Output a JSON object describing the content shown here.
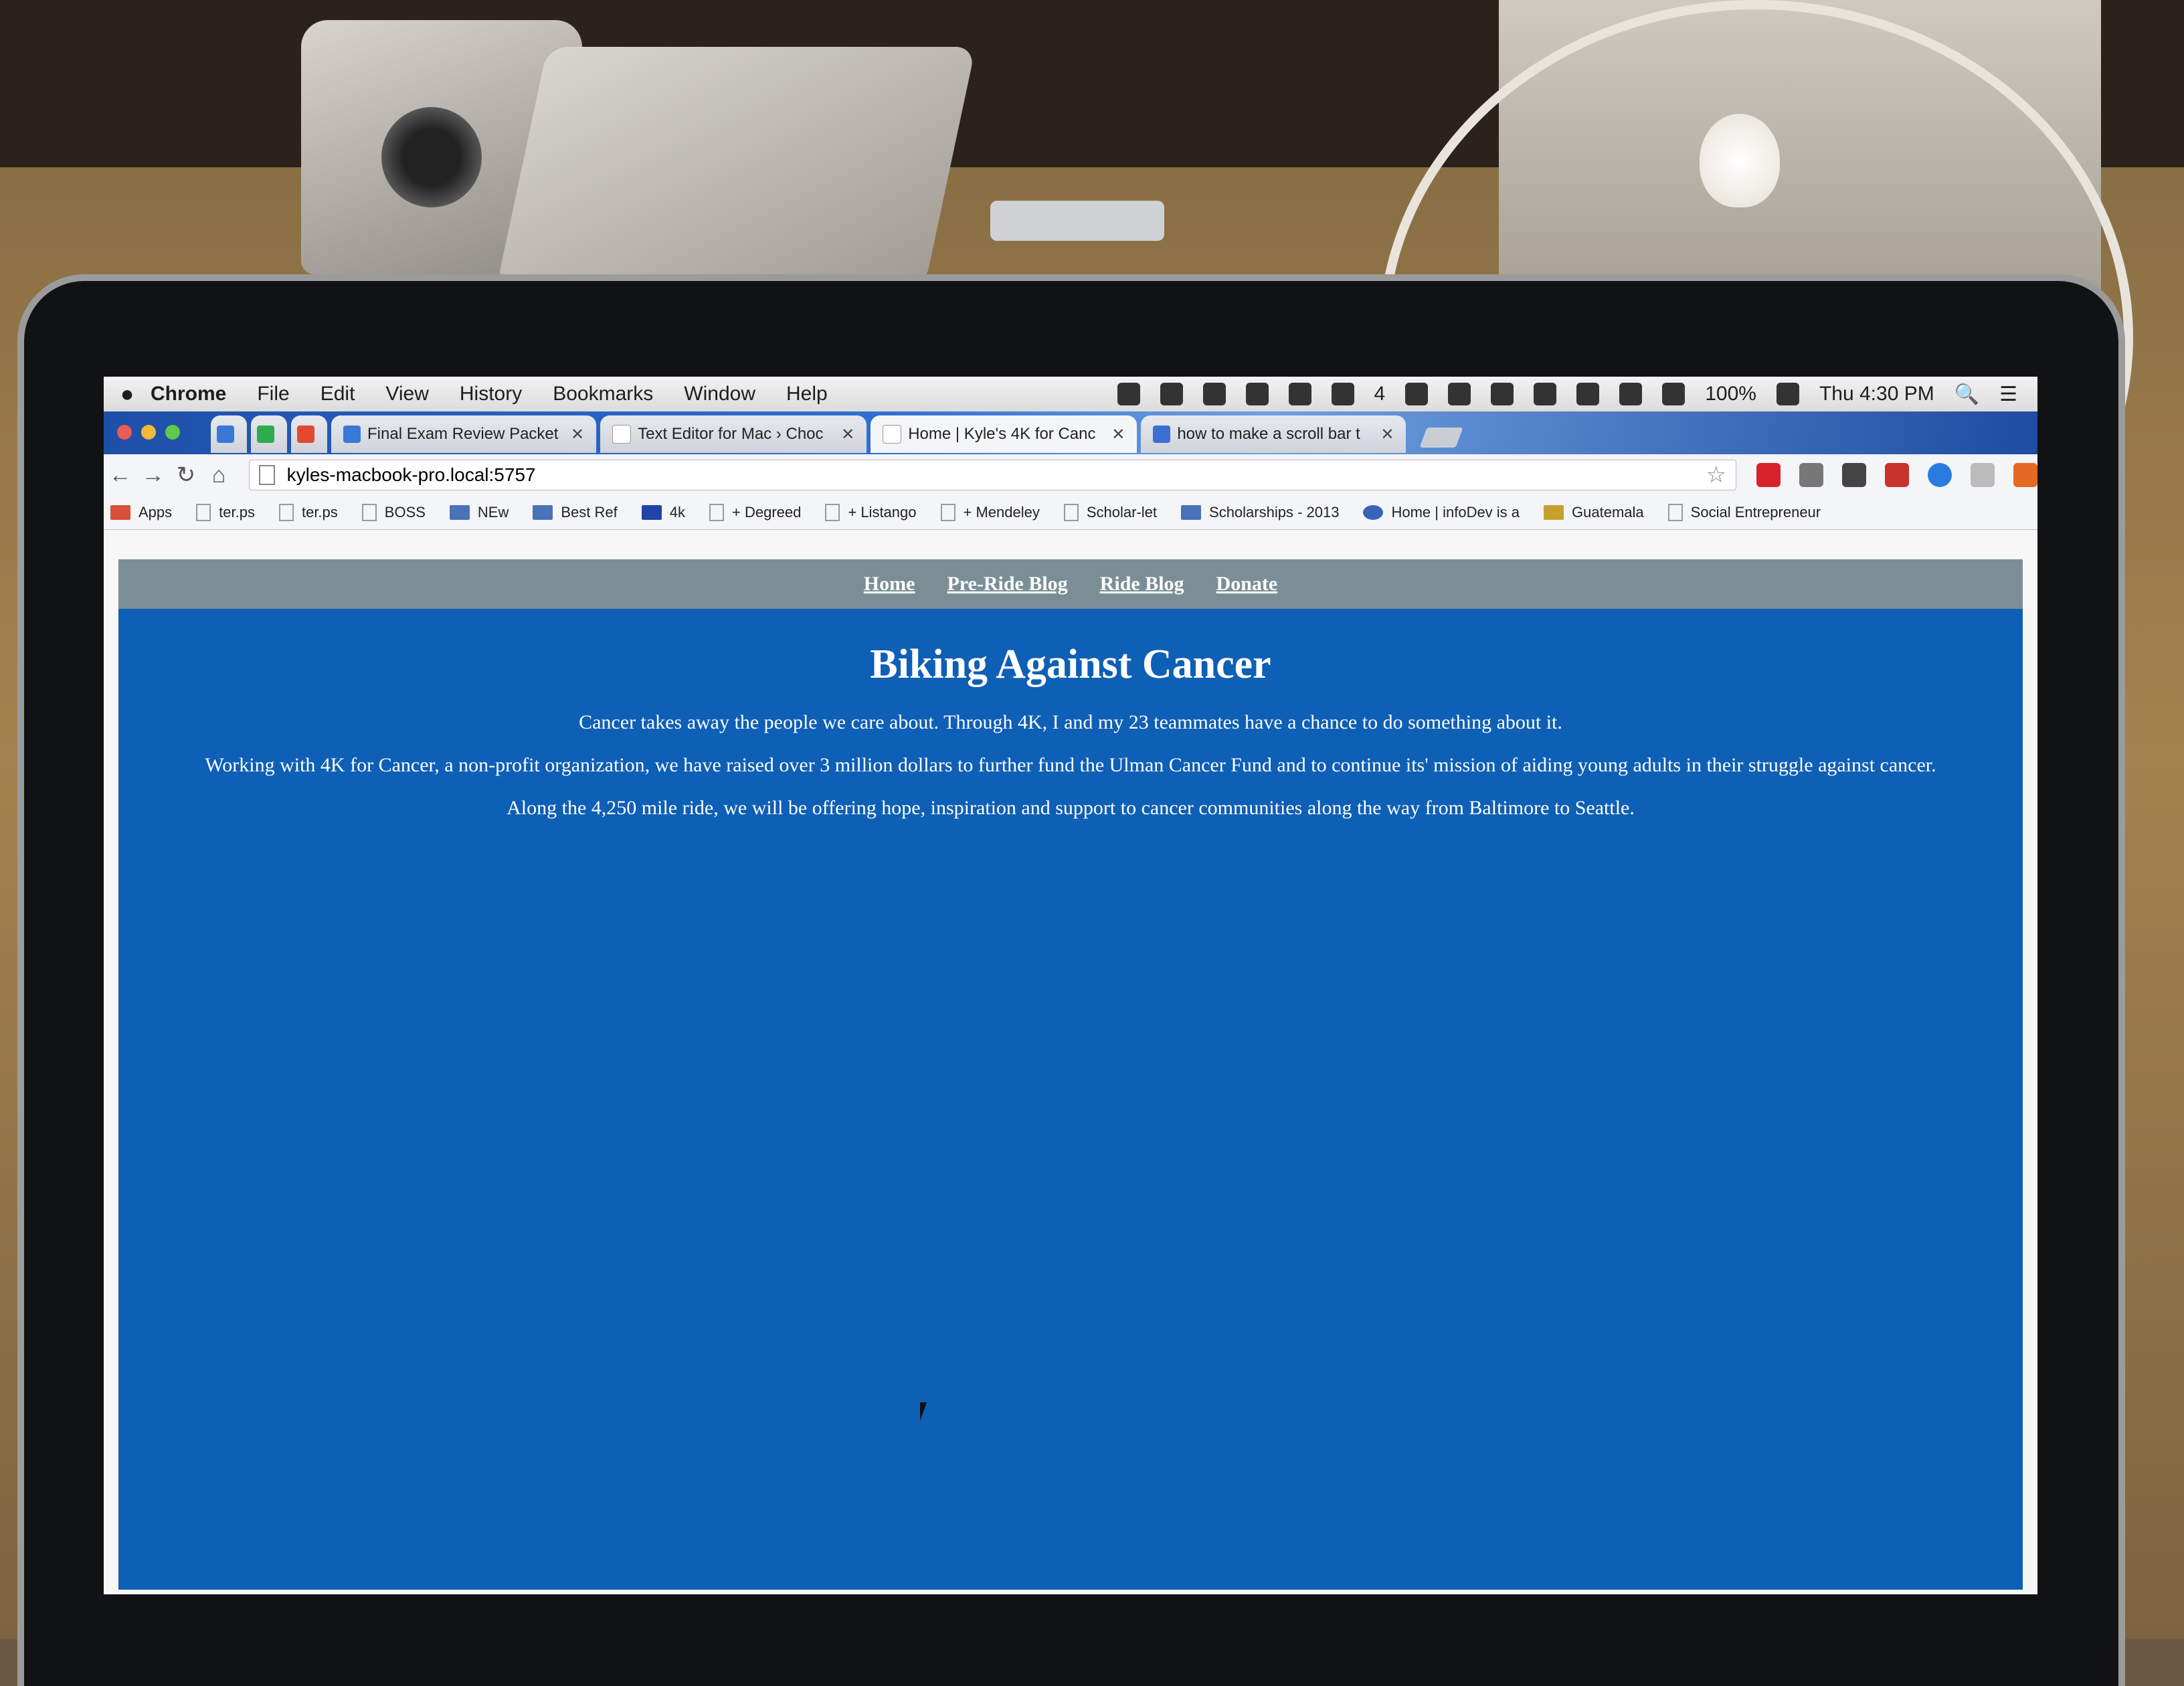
{
  "menubar": {
    "app": "Chrome",
    "items": [
      "File",
      "Edit",
      "View",
      "History",
      "Bookmarks",
      "Window",
      "Help"
    ],
    "battery": "100%",
    "clock": "Thu 4:30 PM",
    "badge": "4"
  },
  "tabs": [
    {
      "title": "Final Exam Review Packet",
      "icon": "docs-icon"
    },
    {
      "title": "Text Editor for Mac › Choc",
      "icon": "page-icon"
    },
    {
      "title": "Home | Kyle's 4K for Canc",
      "icon": "page-icon"
    },
    {
      "title": "how to make a scroll bar t",
      "icon": "google-icon"
    }
  ],
  "omnibox": {
    "url": "kyles-macbook-pro.local:5757"
  },
  "bookmarks": [
    "Apps",
    "ter.ps",
    "ter.ps",
    "BOSS",
    "NEw",
    "Best Ref",
    "4k",
    "+ Degreed",
    "+ Listango",
    "+ Mendeley",
    "Scholar-let",
    "Scholarships - 2013",
    "Home | infoDev is a",
    "Guatemala",
    "Social Entrepreneur"
  ],
  "site": {
    "nav": [
      "Home",
      "Pre-Ride Blog",
      "Ride Blog",
      "Donate"
    ],
    "title": "Biking Against Cancer",
    "paragraphs": [
      "Cancer takes away the people we care about. Through 4K, I and my 23 teammates have a chance to do something about it.",
      "Working with 4K for Cancer, a non-profit organization, we have raised over 3 million dollars to further fund the Ulman Cancer Fund and to continue its' mission of aiding young adults in their struggle against cancer.",
      "Along the 4,250 mile ride, we will be offering hope, inspiration and support to cancer communities along the way from Baltimore to Seattle."
    ]
  },
  "colors": {
    "site_background": "#0e5fb6",
    "nav_bar": "#7b8e95",
    "tab_strip": "#2f6fd1"
  }
}
